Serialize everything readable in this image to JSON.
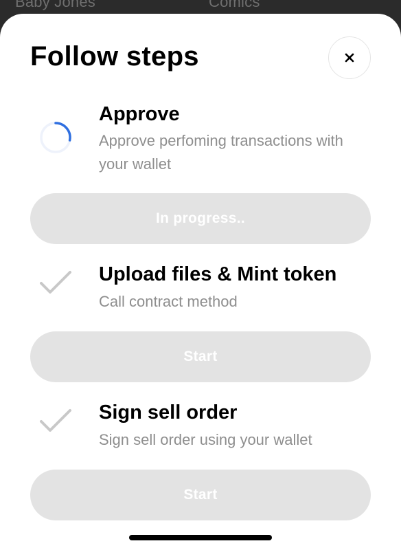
{
  "background": {
    "tabs": [
      "Baby Jones",
      "Comics"
    ]
  },
  "modal": {
    "title": "Follow steps",
    "close_icon": "close-icon",
    "steps": [
      {
        "title": "Approve",
        "description": "Approve perfoming transactions with your wallet",
        "status_icon": "spinner-icon",
        "button_label": "In progress.."
      },
      {
        "title": "Upload files & Mint token",
        "description": "Call contract method",
        "status_icon": "checkmark-icon",
        "button_label": "Start"
      },
      {
        "title": "Sign sell order",
        "description": "Sign sell order using your wallet",
        "status_icon": "checkmark-icon",
        "button_label": "Start"
      }
    ]
  },
  "colors": {
    "spinner_accent": "#2f6fe0",
    "button_disabled": "#e3e3e3",
    "muted_text": "#8e8e8e",
    "check_gray": "#c8c8c8"
  }
}
